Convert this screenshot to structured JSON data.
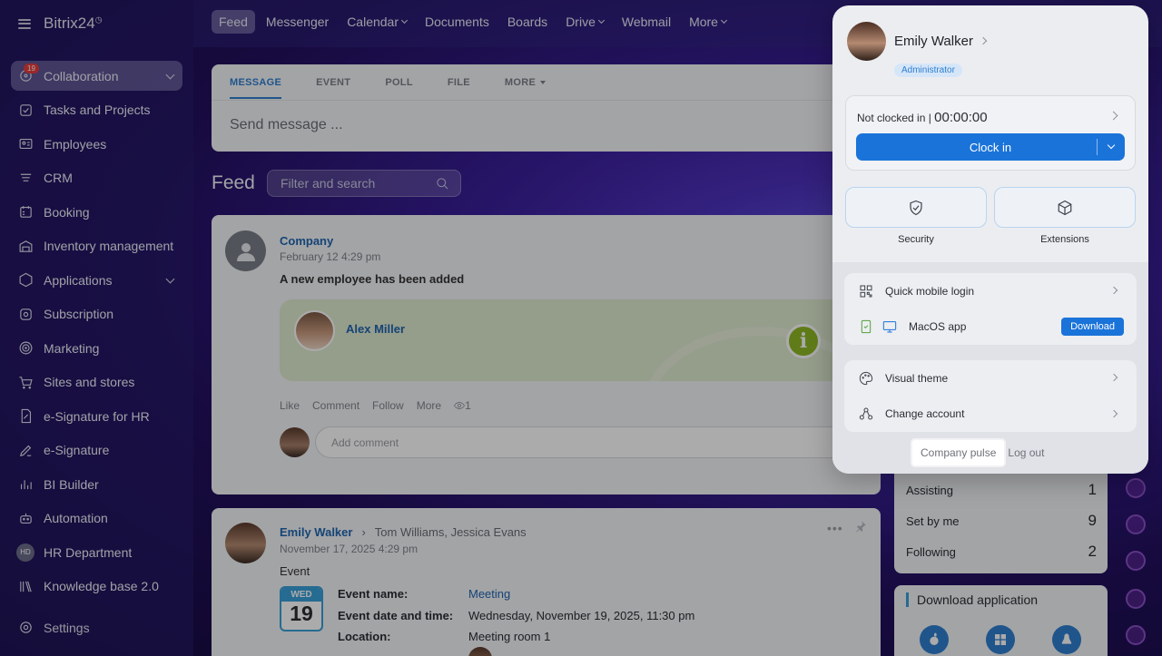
{
  "app": {
    "title": "Bitrix24",
    "title_mark": "◷"
  },
  "sidebar": {
    "items": [
      {
        "label": "Collaboration",
        "icon": "collaboration-icon",
        "badge": "19",
        "active": true,
        "expand": true
      },
      {
        "label": "Tasks and Projects",
        "icon": "tasks-icon"
      },
      {
        "label": "Employees",
        "icon": "employees-icon"
      },
      {
        "label": "CRM",
        "icon": "crm-icon"
      },
      {
        "label": "Booking",
        "icon": "booking-icon"
      },
      {
        "label": "Inventory management",
        "icon": "inventory-icon"
      },
      {
        "label": "Applications",
        "icon": "applications-icon",
        "expand": true
      },
      {
        "label": "Subscription",
        "icon": "subscription-icon"
      },
      {
        "label": "Marketing",
        "icon": "marketing-icon"
      },
      {
        "label": "Sites and stores",
        "icon": "cart-icon"
      },
      {
        "label": "e-Signature for HR",
        "icon": "hr-signature-icon"
      },
      {
        "label": "e-Signature",
        "icon": "pen-icon"
      },
      {
        "label": "BI Builder",
        "icon": "bi-icon"
      },
      {
        "label": "Automation",
        "icon": "robot-icon"
      },
      {
        "label": "HR Department",
        "avatar": "HD"
      },
      {
        "label": "Knowledge base 2.0",
        "icon": "books-icon"
      }
    ],
    "settings_label": "Settings"
  },
  "topnav": {
    "tabs": [
      "Feed",
      "Messenger",
      "Calendar",
      "Documents",
      "Boards",
      "Drive",
      "Webmail",
      "More"
    ]
  },
  "composer": {
    "tabs": [
      "MESSAGE",
      "EVENT",
      "POLL",
      "FILE",
      "MORE"
    ],
    "placeholder": "Send message ..."
  },
  "feed": {
    "title": "Feed",
    "filter_placeholder": "Filter and search"
  },
  "post1": {
    "author": "Company",
    "date": "February 12 4:29 pm",
    "text": "A new employee has been added",
    "employee": "Alex Miller",
    "actions": [
      "Like",
      "Comment",
      "Follow",
      "More"
    ],
    "views": "1",
    "comment_placeholder": "Add comment"
  },
  "post2": {
    "author": "Emily Walker",
    "recipients": "Tom Williams, Jessica Evans",
    "date": "November 17, 2025 4:29 pm",
    "label": "Event",
    "cal_day": "WED",
    "cal_num": "19",
    "fields": [
      {
        "k": "Event name:",
        "v": "Meeting"
      },
      {
        "k": "Event date and time:",
        "v": "Wednesday, November 19, 2025, 11:30 pm"
      },
      {
        "k": "Location:",
        "v": "Meeting room 1"
      }
    ]
  },
  "tasks_widget": {
    "rows": [
      {
        "label": "Assisting",
        "count": "1"
      },
      {
        "label": "Set by me",
        "count": "9"
      },
      {
        "label": "Following",
        "count": "2"
      }
    ]
  },
  "download_widget": {
    "title": "Download application"
  },
  "popup": {
    "name": "Emily Walker",
    "role": "Administrator",
    "clock_status": "Not clocked in |",
    "clock_time": "00:00:00",
    "clock_button": "Clock in",
    "tiles": [
      "Security",
      "Extensions"
    ],
    "quick_login": "Quick mobile login",
    "macos": "MacOS app",
    "download": "Download",
    "visual_theme": "Visual theme",
    "change_account": "Change account",
    "company_pulse": "Company pulse",
    "logout": "Log out"
  }
}
